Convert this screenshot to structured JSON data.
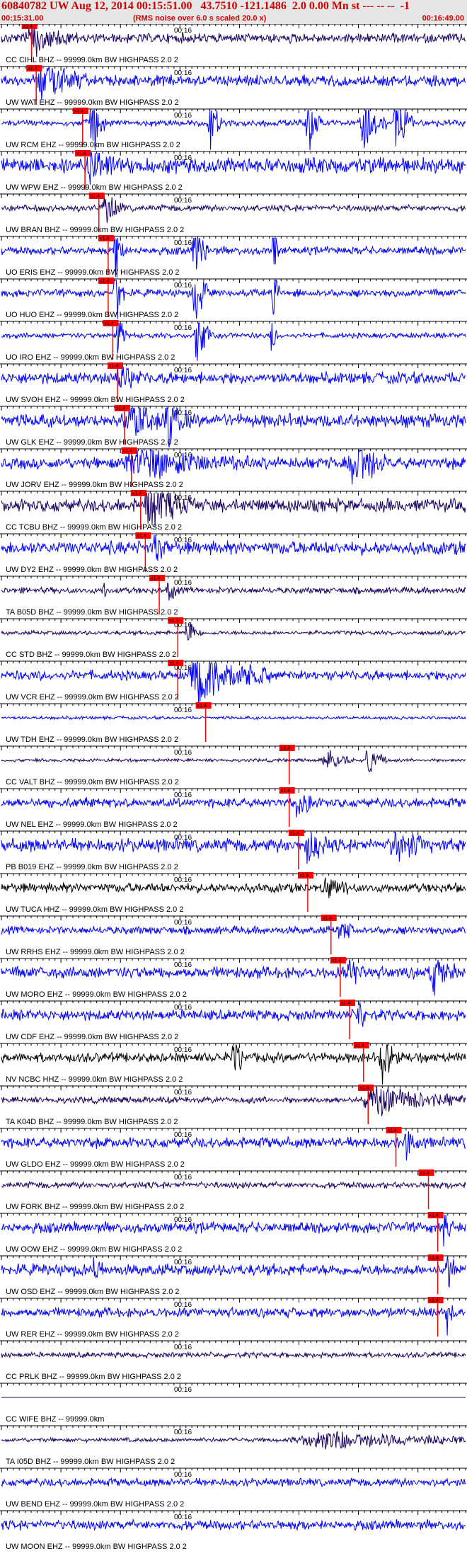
{
  "header": {
    "title": "60840782 UW Aug 12, 2014 00:15:51.00   43.7510 -121.1486  2.0 0.00 Mn st --- -- --  -1",
    "start_time": "00:15:31.00",
    "note": "(RMS noise over 6.0 s scaled 20.0 x)",
    "end_time": "00:16:49.00"
  },
  "colors": {
    "header_text": "#cc0000",
    "header_bg": "#e6e6e6",
    "trace_blue": "#0000ff",
    "trace_dark": "#1a0060",
    "trace_black": "#000000",
    "pick": "#ff0000",
    "label": "#000000"
  },
  "time_tick_label": "00:16",
  "pick_label": "x1.4",
  "traces": [
    {
      "label": "CC CIHL BHZ -- 99999.0km BW  HIGHPASS  2.0  2",
      "color": "dark",
      "amp": 0.18,
      "pick": 0.065,
      "bursts": [
        [
          0.07,
          0.1,
          0.6
        ]
      ]
    },
    {
      "label": "UW WAT EHZ -- 99999.0km BW  HIGHPASS  2.0  2",
      "color": "blue",
      "amp": 0.2,
      "pick": 0.075,
      "bursts": [
        [
          0.09,
          0.1,
          0.9
        ]
      ]
    },
    {
      "label": "UW RCM EHZ -- 99999.0km BW  HIGHPASS  2.0  2",
      "color": "blue",
      "amp": 0.12,
      "pick": 0.175,
      "bursts": [
        [
          0.195,
          0.03,
          1.8
        ],
        [
          0.45,
          0.025,
          1.4
        ],
        [
          0.66,
          0.03,
          1.4
        ],
        [
          0.78,
          0.05,
          1.3
        ],
        [
          0.85,
          0.04,
          1.4
        ]
      ]
    },
    {
      "label": "UW WPW EHZ -- 99999.0km BW  HIGHPASS  2.0  2",
      "color": "blue",
      "amp": 0.3,
      "pick": 0.18,
      "bursts": [
        [
          0.195,
          0.05,
          1.0
        ]
      ]
    },
    {
      "label": "UW BRAN BHZ -- 99999.0km BW  HIGHPASS  2.0  2",
      "color": "dark",
      "amp": 0.12,
      "pick": 0.21,
      "bursts": [
        [
          0.225,
          0.04,
          0.8
        ]
      ]
    },
    {
      "label": "UO ERIS EHZ -- 99999.0km BW  HIGHPASS  2.0  2",
      "color": "blue",
      "amp": 0.15,
      "pick": 0.23,
      "bursts": [
        [
          0.245,
          0.02,
          2.0
        ],
        [
          0.415,
          0.03,
          1.8
        ],
        [
          0.585,
          0.015,
          1.5
        ]
      ]
    },
    {
      "label": "UO HUO EHZ -- 99999.0km BW  HIGHPASS  2.0  2",
      "color": "blue",
      "amp": 0.14,
      "pick": 0.23,
      "bursts": [
        [
          0.245,
          0.02,
          2.0
        ],
        [
          0.415,
          0.03,
          1.8
        ],
        [
          0.585,
          0.015,
          1.5
        ]
      ]
    },
    {
      "label": "UO IRO EHZ -- 99999.0km BW  HIGHPASS  2.0  2",
      "color": "blue",
      "amp": 0.1,
      "pick": 0.24,
      "bursts": [
        [
          0.25,
          0.02,
          1.6
        ],
        [
          0.42,
          0.03,
          1.8
        ],
        [
          0.58,
          0.015,
          1.2
        ]
      ]
    },
    {
      "label": "UW SVOH EHZ -- 99999.0km BW  HIGHPASS  2.0  2",
      "color": "blue",
      "amp": 0.22,
      "pick": 0.25,
      "bursts": [
        [
          0.255,
          0.05,
          0.6
        ]
      ]
    },
    {
      "label": "UW GLK EHZ -- 99999.0km BW  HIGHPASS  2.0  2",
      "color": "blue",
      "amp": 0.25,
      "pick": 0.265,
      "bursts": [
        [
          0.28,
          0.1,
          0.8
        ],
        [
          0.36,
          0.05,
          0.9
        ]
      ]
    },
    {
      "label": "UW JORV EHZ -- 99999.0km BW  HIGHPASS  2.0  2",
      "color": "blue",
      "amp": 0.22,
      "pick": 0.28,
      "bursts": [
        [
          0.3,
          0.25,
          0.6
        ],
        [
          0.76,
          0.07,
          1.5
        ]
      ]
    },
    {
      "label": "CC TCBU BHZ -- 99999.0km BW  HIGHPASS  2.0  2",
      "color": "dark",
      "amp": 0.25,
      "pick": 0.3,
      "bursts": [
        [
          0.32,
          0.1,
          0.9
        ]
      ]
    },
    {
      "label": "UW DY2 EHZ -- 99999.0km BW  HIGHPASS  2.0  2",
      "color": "blue",
      "amp": 0.25,
      "pick": 0.31,
      "bursts": [
        [
          0.33,
          0.03,
          0.8
        ]
      ]
    },
    {
      "label": "TA B05D BHZ -- 99999.0km BW  HIGHPASS  2.0  2",
      "color": "dark",
      "amp": 0.12,
      "pick": 0.34,
      "bursts": [
        [
          0.36,
          0.02,
          0.6
        ],
        [
          0.22,
          0.01,
          0.4
        ]
      ]
    },
    {
      "label": "CC STD BHZ -- 99999.0km BW  HIGHPASS  2.0  2",
      "color": "dark",
      "amp": 0.08,
      "pick": 0.38,
      "bursts": [
        [
          0.4,
          0.03,
          0.6
        ]
      ]
    },
    {
      "label": "UW VCR EHZ -- 99999.0km BW  HIGHPASS  2.0  2",
      "color": "blue",
      "amp": 0.18,
      "pick": 0.38,
      "bursts": [
        [
          0.43,
          0.15,
          1.4
        ]
      ]
    },
    {
      "label": "UW TDH EHZ -- 99999.0km BW  HIGHPASS  2.0  2",
      "color": "blue",
      "amp": 0.06,
      "pick": 0.44,
      "bursts": []
    },
    {
      "label": "CC VALT BHZ -- 99999.0km BW  HIGHPASS  2.0  2",
      "color": "dark",
      "amp": 0.06,
      "pick": 0.62,
      "bursts": [
        [
          0.7,
          0.06,
          0.5
        ],
        [
          0.79,
          0.04,
          1.0
        ]
      ]
    },
    {
      "label": "UW NEL EHZ -- 99999.0km BW  HIGHPASS  2.0  2",
      "color": "blue",
      "amp": 0.18,
      "pick": 0.62,
      "bursts": [
        [
          0.64,
          0.04,
          0.7
        ]
      ]
    },
    {
      "label": "PB B019 EHZ -- 99999.0km BW  HIGHPASS  2.0  2",
      "color": "blue",
      "amp": 0.25,
      "pick": 0.64,
      "bursts": [
        [
          0.66,
          0.04,
          1.0
        ],
        [
          0.85,
          0.08,
          0.6
        ]
      ]
    },
    {
      "label": "UW TUCA HHZ -- 99999.0km BW  HIGHPASS  2.0  2",
      "color": "black",
      "amp": 0.18,
      "pick": 0.66,
      "bursts": [
        [
          0.7,
          0.05,
          0.5
        ]
      ]
    },
    {
      "label": "UW RRHS EHZ -- 99999.0km BW  HIGHPASS  2.0  2",
      "color": "blue",
      "amp": 0.15,
      "pick": 0.71,
      "bursts": [
        [
          0.73,
          0.03,
          0.6
        ]
      ]
    },
    {
      "label": "UW MORO EHZ -- 99999.0km BW  HIGHPASS  2.0  2",
      "color": "blue",
      "amp": 0.22,
      "pick": 0.73,
      "bursts": [
        [
          0.75,
          0.03,
          0.8
        ],
        [
          0.93,
          0.05,
          0.8
        ]
      ]
    },
    {
      "label": "UW CDF EHZ -- 99999.0km BW  HIGHPASS  2.0  2",
      "color": "blue",
      "amp": 0.2,
      "pick": 0.75,
      "bursts": [
        [
          0.77,
          0.02,
          0.9
        ]
      ]
    },
    {
      "label": "NV NCBC HHZ -- 99999.0km BW  HIGHPASS  2.0  2",
      "color": "black",
      "amp": 0.18,
      "pick": 0.78,
      "bursts": [
        [
          0.5,
          0.03,
          0.7
        ],
        [
          0.82,
          0.04,
          1.0
        ]
      ]
    },
    {
      "label": "TA K04D BHZ -- 99999.0km BW  HIGHPASS  2.0  2",
      "color": "dark",
      "amp": 0.12,
      "pick": 0.79,
      "bursts": [
        [
          0.81,
          0.2,
          0.6
        ]
      ]
    },
    {
      "label": "UW GLDO EHZ -- 99999.0km BW  HIGHPASS  2.0  2",
      "color": "blue",
      "amp": 0.2,
      "pick": 0.85,
      "bursts": [
        [
          0.87,
          0.03,
          0.7
        ]
      ]
    },
    {
      "label": "UW FORK BHZ -- 99999.0km BW  HIGHPASS  2.0  2",
      "color": "dark",
      "amp": 0.12,
      "pick": 0.92,
      "bursts": []
    },
    {
      "label": "UW OOW EHZ -- 99999.0km BW  HIGHPASS  2.0  2",
      "color": "blue",
      "amp": 0.2,
      "pick": 0.94,
      "bursts": [
        [
          0.955,
          0.02,
          1.2
        ]
      ]
    },
    {
      "label": "UW OSD EHZ -- 99999.0km BW  HIGHPASS  2.0  2",
      "color": "blue",
      "amp": 0.22,
      "pick": 0.94,
      "bursts": [
        [
          0.2,
          0.02,
          0.5
        ],
        [
          0.96,
          0.02,
          1.0
        ]
      ]
    },
    {
      "label": "UW RER EHZ -- 99999.0km BW  HIGHPASS  2.0  2",
      "color": "blue",
      "amp": 0.18,
      "pick": 0.94,
      "bursts": [
        [
          0.96,
          0.02,
          0.9
        ]
      ]
    },
    {
      "label": "CC PRLK BHZ -- 99999.0km BW  HIGHPASS  2.0  2",
      "color": "dark",
      "amp": 0.1,
      "pick": null,
      "bursts": []
    },
    {
      "label": "CC WIFE BHZ -- 99999.0km",
      "color": "dark",
      "amp": 0.0,
      "pick": null,
      "bursts": []
    },
    {
      "label": "TA I05D BHZ -- 99999.0km BW  HIGHPASS  2.0  2",
      "color": "dark",
      "amp": 0.08,
      "pick": null,
      "bursts": [
        [
          0.7,
          0.4,
          0.4
        ]
      ]
    },
    {
      "label": "UW BEND EHZ -- 99999.0km BW  HIGHPASS  2.0  2",
      "color": "blue",
      "amp": 0.15,
      "pick": null,
      "bursts": []
    },
    {
      "label": "UW MOON EHZ -- 99999.0km BW  HIGHPASS  2.0  2",
      "color": "blue",
      "amp": 0.18,
      "pick": null,
      "bursts": []
    }
  ]
}
